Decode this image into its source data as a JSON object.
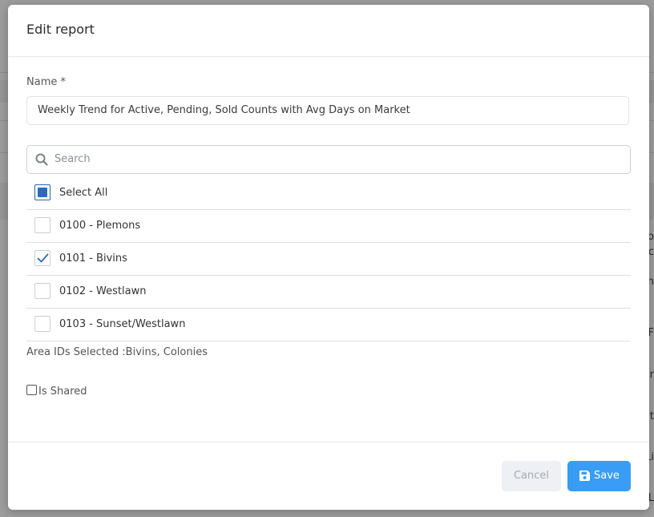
{
  "modal": {
    "title": "Edit report",
    "name_label": "Name *",
    "name_value": "Weekly Trend for Active, Pending, Sold Counts with Avg Days on Market",
    "search_placeholder": "Search",
    "list": {
      "select_all_label": "Select All",
      "select_all_state": "partial",
      "items": [
        {
          "label": "0100 - Plemons",
          "checked": false
        },
        {
          "label": "0101 - Bivins",
          "checked": true
        },
        {
          "label": "0102 - Westlawn",
          "checked": false
        },
        {
          "label": "0103 - Sunset/Westlawn",
          "checked": false
        }
      ]
    },
    "selected_summary": "Area IDs Selected :Bivins, Colonies",
    "is_shared_label": "Is Shared",
    "is_shared_checked": false,
    "footer": {
      "cancel_label": "Cancel",
      "save_label": "Save"
    }
  },
  "background_fragments": [
    "o",
    "c",
    "n",
    "F",
    "ir",
    "nt",
    "Li",
    "L"
  ],
  "colors": {
    "accent": "#3a9df5",
    "checkbox_fill": "#2e6bbf",
    "overlay": "#8f8f8f"
  },
  "icons": {
    "search": "search-icon",
    "check": "check-icon",
    "save": "floppy-disk-icon"
  }
}
